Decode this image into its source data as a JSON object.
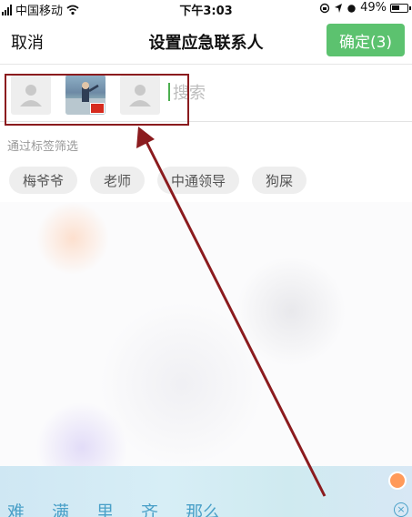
{
  "status_bar": {
    "carrier": "中国移动",
    "time": "下午3:03",
    "battery": "49%",
    "icons": [
      "signal-icon",
      "wifi-icon",
      "lock-rotation-icon",
      "location-icon",
      "alarm-icon",
      "battery-icon"
    ]
  },
  "nav": {
    "cancel_label": "取消",
    "title": "设置应急联系人",
    "confirm_label": "确定(3)"
  },
  "selected_contacts": [
    {
      "avatar": "default-avatar-icon"
    },
    {
      "avatar": "photo-avatar"
    },
    {
      "avatar": "default-avatar-icon"
    }
  ],
  "search": {
    "placeholder": "搜索",
    "value": ""
  },
  "tag_filter": {
    "label": "通过标签筛选",
    "tags": [
      "梅爷爷",
      "老师",
      "中通领导",
      "狗屎"
    ]
  },
  "keyboard": {
    "candidates": [
      "难",
      "满",
      "里",
      "齐",
      "那么"
    ]
  },
  "colors": {
    "accent": "#5cc26f",
    "annotation": "#8b1b1e",
    "keyboard_text": "#4aa0c8"
  }
}
